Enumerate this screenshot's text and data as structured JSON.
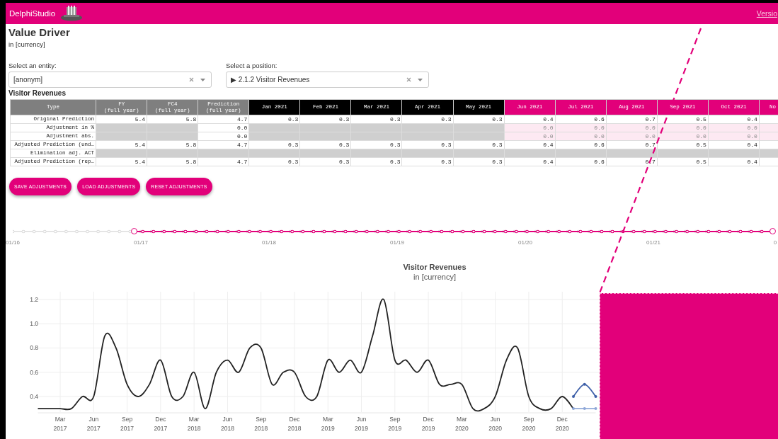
{
  "header": {
    "app_name": "DelphiStudio",
    "link": "Versio"
  },
  "page": {
    "title": "Value Driver",
    "subtitle": "in [currency]"
  },
  "selects": [
    {
      "label": "Select an entity:",
      "value": "[anonym]"
    },
    {
      "label": "Select a position:",
      "value": "▶ 2.1.2 Visitor Revenues"
    }
  ],
  "table": {
    "title": "Visitor Revenues",
    "columns": [
      {
        "label": "Type",
        "kind": "type"
      },
      {
        "label": "FY",
        "sub": "(full year)",
        "kind": "actual"
      },
      {
        "label": "FC4",
        "sub": "(full year)",
        "kind": "actual"
      },
      {
        "label": "Prediction",
        "sub": "(full year)",
        "kind": "actual"
      },
      {
        "label": "Jan 2021",
        "kind": "past"
      },
      {
        "label": "Feb 2021",
        "kind": "past"
      },
      {
        "label": "Mar 2021",
        "kind": "past"
      },
      {
        "label": "Apr 2021",
        "kind": "past"
      },
      {
        "label": "May 2021",
        "kind": "past"
      },
      {
        "label": "Jun 2021",
        "kind": "forecast"
      },
      {
        "label": "Jul 2021",
        "kind": "forecast"
      },
      {
        "label": "Aug 2021",
        "kind": "forecast"
      },
      {
        "label": "Sep 2021",
        "kind": "forecast"
      },
      {
        "label": "Oct 2021",
        "kind": "forecast"
      },
      {
        "label": "No",
        "kind": "forecast"
      }
    ],
    "rows": [
      {
        "type": "Original Prediction",
        "kind": "value",
        "cells": [
          {
            "kind": "value",
            "text": "5.4"
          },
          {
            "kind": "value",
            "text": "5.8"
          },
          {
            "kind": "value",
            "text": "4.7"
          },
          {
            "kind": "value",
            "text": "0.3"
          },
          {
            "kind": "value",
            "text": "0.3"
          },
          {
            "kind": "value",
            "text": "0.3"
          },
          {
            "kind": "value",
            "text": "0.3"
          },
          {
            "kind": "value",
            "text": "0.3"
          },
          {
            "kind": "value",
            "text": "0.4"
          },
          {
            "kind": "value",
            "text": "0.6"
          },
          {
            "kind": "value",
            "text": "0.7"
          },
          {
            "kind": "value",
            "text": "0.5"
          },
          {
            "kind": "value",
            "text": "0.4"
          }
        ]
      },
      {
        "type": "Adjustment in %",
        "kind": "adjustment",
        "cells": [
          {
            "kind": "empty"
          },
          {
            "kind": "empty"
          },
          {
            "kind": "value",
            "text": "0.0"
          },
          {
            "kind": "empty"
          },
          {
            "kind": "empty"
          },
          {
            "kind": "empty"
          },
          {
            "kind": "empty"
          },
          {
            "kind": "empty"
          },
          {
            "kind": "value",
            "text": "0.0"
          },
          {
            "kind": "value",
            "text": "0.0"
          },
          {
            "kind": "value",
            "text": "0.0"
          },
          {
            "kind": "value",
            "text": "0.0"
          },
          {
            "kind": "value",
            "text": "0.0"
          }
        ]
      },
      {
        "type": "Adjustment abs.",
        "kind": "adjustment",
        "cells": [
          {
            "kind": "empty"
          },
          {
            "kind": "empty"
          },
          {
            "kind": "value",
            "text": "0.0"
          },
          {
            "kind": "empty"
          },
          {
            "kind": "empty"
          },
          {
            "kind": "empty"
          },
          {
            "kind": "empty"
          },
          {
            "kind": "empty"
          },
          {
            "kind": "value",
            "text": "0.0"
          },
          {
            "kind": "value",
            "text": "0.0"
          },
          {
            "kind": "value",
            "text": "0.0"
          },
          {
            "kind": "value",
            "text": "0.0"
          },
          {
            "kind": "value",
            "text": "0.0"
          }
        ]
      },
      {
        "type": "Adjusted Prediction (und…",
        "kind": "value",
        "cells": [
          {
            "kind": "value",
            "text": "5.4"
          },
          {
            "kind": "value",
            "text": "5.8"
          },
          {
            "kind": "value",
            "text": "4.7"
          },
          {
            "kind": "value",
            "text": "0.3"
          },
          {
            "kind": "value",
            "text": "0.3"
          },
          {
            "kind": "value",
            "text": "0.3"
          },
          {
            "kind": "value",
            "text": "0.3"
          },
          {
            "kind": "value",
            "text": "0.3"
          },
          {
            "kind": "value",
            "text": "0.4"
          },
          {
            "kind": "value",
            "text": "0.6"
          },
          {
            "kind": "value",
            "text": "0.7"
          },
          {
            "kind": "value",
            "text": "0.5"
          },
          {
            "kind": "value",
            "text": "0.4"
          }
        ]
      },
      {
        "type": "Elimination adj. ACT",
        "kind": "elimination"
      },
      {
        "type": "Adjusted Prediction (rep…",
        "kind": "value",
        "cells": [
          {
            "kind": "value",
            "text": "5.4"
          },
          {
            "kind": "value",
            "text": "5.8"
          },
          {
            "kind": "value",
            "text": "4.7"
          },
          {
            "kind": "value",
            "text": "0.3"
          },
          {
            "kind": "value",
            "text": "0.3"
          },
          {
            "kind": "value",
            "text": "0.3"
          },
          {
            "kind": "value",
            "text": "0.3"
          },
          {
            "kind": "value",
            "text": "0.3"
          },
          {
            "kind": "value",
            "text": "0.4"
          },
          {
            "kind": "value",
            "text": "0.6"
          },
          {
            "kind": "value",
            "text": "0.7"
          },
          {
            "kind": "value",
            "text": "0.5"
          },
          {
            "kind": "value",
            "text": "0.4"
          }
        ]
      }
    ]
  },
  "buttons": [
    "SAVE ADJUSTMENTS",
    "LOAD ADJUSTMENTS",
    "RESET ADJUSTMENTS"
  ],
  "timeline": {
    "labels": [
      "01/16",
      "01/17",
      "01/18",
      "01/19",
      "01/20",
      "01/21",
      "0"
    ],
    "level": 0.84
  },
  "chart": {
    "subtitle": "in [currency]",
    "chart_data": {
      "type": "line",
      "title": "Visitor Revenues",
      "grid": true,
      "x": [
        "2017-01",
        "2017-02",
        "2017-03",
        "2017-04",
        "2017-05",
        "2017-06",
        "2017-07",
        "2017-08",
        "2017-09",
        "2017-10",
        "2017-11",
        "2017-12",
        "2018-01",
        "2018-02",
        "2018-03",
        "2018-04",
        "2018-05",
        "2018-06",
        "2018-07",
        "2018-08",
        "2018-09",
        "2018-10",
        "2018-11",
        "2018-12",
        "2019-01",
        "2019-02",
        "2019-03",
        "2019-04",
        "2019-05",
        "2019-06",
        "2019-07",
        "2019-08",
        "2019-09",
        "2019-10",
        "2019-11",
        "2019-12",
        "2020-01",
        "2020-02",
        "2020-03",
        "2020-04",
        "2020-05",
        "2020-06",
        "2020-07",
        "2020-08",
        "2020-09",
        "2020-10",
        "2020-11",
        "2020-12",
        "2021-01",
        "2021-02",
        "2021-03"
      ],
      "series": [
        {
          "color": "#222222",
          "values": [
            0.3,
            0.3,
            0.3,
            0.3,
            0.4,
            0.4,
            0.9,
            0.8,
            0.5,
            0.4,
            0.5,
            0.7,
            0.4,
            0.4,
            0.6,
            0.3,
            0.6,
            0.7,
            0.6,
            0.8,
            0.8,
            0.5,
            0.6,
            0.6,
            0.4,
            0.4,
            0.7,
            0.6,
            0.7,
            0.6,
            0.9,
            1.2,
            0.7,
            0.7,
            0.6,
            0.7,
            0.5,
            0.5,
            0.5,
            0.3,
            0.3,
            0.4,
            0.7,
            0.8,
            0.4,
            0.3,
            0.3,
            0.4,
            0.3,
            null,
            null
          ]
        },
        {
          "color": "#3d5fa8",
          "values": [
            null,
            null,
            null,
            null,
            null,
            null,
            null,
            null,
            null,
            null,
            null,
            null,
            null,
            null,
            null,
            null,
            null,
            null,
            null,
            null,
            null,
            null,
            null,
            null,
            null,
            null,
            null,
            null,
            null,
            null,
            null,
            null,
            null,
            null,
            null,
            null,
            null,
            null,
            null,
            null,
            null,
            null,
            null,
            null,
            null,
            null,
            null,
            null,
            0.4,
            0.5,
            0.4
          ]
        },
        {
          "color": "#8fa8d8",
          "values": [
            null,
            null,
            null,
            null,
            null,
            null,
            null,
            null,
            null,
            null,
            null,
            null,
            null,
            null,
            null,
            null,
            null,
            null,
            null,
            null,
            null,
            null,
            null,
            null,
            null,
            null,
            null,
            null,
            null,
            null,
            null,
            null,
            null,
            null,
            null,
            null,
            null,
            null,
            null,
            null,
            null,
            null,
            null,
            null,
            null,
            null,
            null,
            null,
            0.3,
            0.3,
            0.3
          ]
        }
      ],
      "xlim": [
        "2017-01",
        "2021-03"
      ],
      "ylim": [
        0.28,
        1.25
      ],
      "yticks": [
        {
          "value": 0.4,
          "label": "0.4"
        },
        {
          "value": 0.6,
          "label": "0.6"
        },
        {
          "value": 0.8,
          "label": "0.8"
        },
        {
          "value": 1,
          "label": "1.0"
        },
        {
          "value": 1.2,
          "label": "1.2"
        }
      ],
      "xticks": [
        {
          "value": "2017-03",
          "label": "Mar 2017"
        },
        {
          "value": "2017-06",
          "label": "Jun 2017"
        },
        {
          "value": "2017-09",
          "label": "Sep 2017"
        },
        {
          "value": "2017-12",
          "label": "Dec 2017"
        },
        {
          "value": "2018-03",
          "label": "Mar 2018"
        },
        {
          "value": "2018-06",
          "label": "Jun 2018"
        },
        {
          "value": "2018-09",
          "label": "Sep 2018"
        },
        {
          "value": "2018-12",
          "label": "Dec 2018"
        },
        {
          "value": "2019-03",
          "label": "Mar 2019"
        },
        {
          "value": "2019-06",
          "label": "Jun 2019"
        },
        {
          "value": "2019-09",
          "label": "Sep 2019"
        },
        {
          "value": "2019-12",
          "label": "Dec 2019"
        },
        {
          "value": "2020-03",
          "label": "Mar 2020"
        },
        {
          "value": "2020-06",
          "label": "Jun 2020"
        },
        {
          "value": "2020-09",
          "label": "Sep 2020"
        },
        {
          "value": "2020-12",
          "label": "Dec 2020"
        }
      ]
    }
  }
}
